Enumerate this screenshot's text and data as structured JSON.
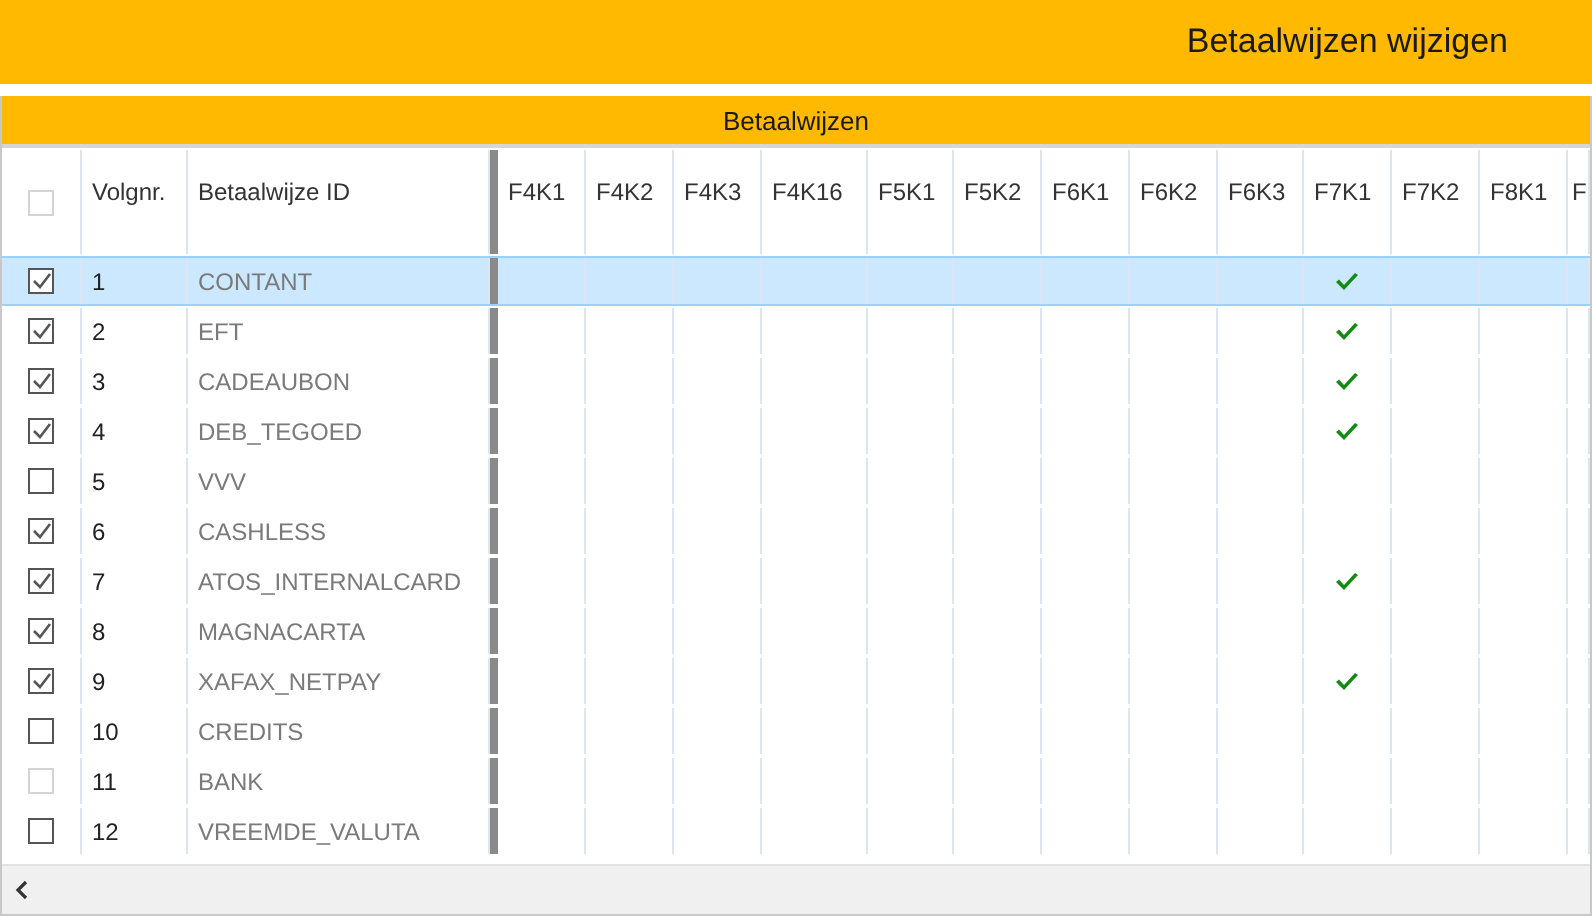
{
  "window": {
    "title": "Betaalwijzen wijzigen"
  },
  "section": {
    "title": "Betaalwijzen"
  },
  "table": {
    "select_all": {
      "checked": false,
      "disabled": true
    },
    "columns": [
      "Volgnr.",
      "Betaalwijze ID"
    ],
    "flag_columns": [
      "F4K1",
      "F4K2",
      "F4K3",
      "F4K16",
      "F5K1",
      "F5K2",
      "F6K1",
      "F6K2",
      "F6K3",
      "F7K1",
      "F7K2",
      "F8K1",
      "F"
    ],
    "rows": [
      {
        "checked": true,
        "disabled": false,
        "selected": true,
        "number": "1",
        "id": "CONTANT",
        "flags": [
          false,
          false,
          false,
          false,
          false,
          false,
          false,
          false,
          false,
          true,
          false,
          false
        ]
      },
      {
        "checked": true,
        "disabled": false,
        "selected": false,
        "number": "2",
        "id": "EFT",
        "flags": [
          false,
          false,
          false,
          false,
          false,
          false,
          false,
          false,
          false,
          true,
          false,
          false
        ]
      },
      {
        "checked": true,
        "disabled": false,
        "selected": false,
        "number": "3",
        "id": "CADEAUBON",
        "flags": [
          false,
          false,
          false,
          false,
          false,
          false,
          false,
          false,
          false,
          true,
          false,
          false
        ]
      },
      {
        "checked": true,
        "disabled": false,
        "selected": false,
        "number": "4",
        "id": "DEB_TEGOED",
        "flags": [
          false,
          false,
          false,
          false,
          false,
          false,
          false,
          false,
          false,
          true,
          false,
          false
        ]
      },
      {
        "checked": false,
        "disabled": false,
        "selected": false,
        "number": "5",
        "id": "VVV",
        "flags": [
          false,
          false,
          false,
          false,
          false,
          false,
          false,
          false,
          false,
          false,
          false,
          false
        ]
      },
      {
        "checked": true,
        "disabled": false,
        "selected": false,
        "number": "6",
        "id": "CASHLESS",
        "flags": [
          false,
          false,
          false,
          false,
          false,
          false,
          false,
          false,
          false,
          false,
          false,
          false
        ]
      },
      {
        "checked": true,
        "disabled": false,
        "selected": false,
        "number": "7",
        "id": "ATOS_INTERNALCARD",
        "flags": [
          false,
          false,
          false,
          false,
          false,
          false,
          false,
          false,
          false,
          true,
          false,
          false
        ]
      },
      {
        "checked": true,
        "disabled": false,
        "selected": false,
        "number": "8",
        "id": "MAGNACARTA",
        "flags": [
          false,
          false,
          false,
          false,
          false,
          false,
          false,
          false,
          false,
          false,
          false,
          false
        ]
      },
      {
        "checked": true,
        "disabled": false,
        "selected": false,
        "number": "9",
        "id": "XAFAX_NETPAY",
        "flags": [
          false,
          false,
          false,
          false,
          false,
          false,
          false,
          false,
          false,
          true,
          false,
          false
        ]
      },
      {
        "checked": false,
        "disabled": false,
        "selected": false,
        "number": "10",
        "id": "CREDITS",
        "flags": [
          false,
          false,
          false,
          false,
          false,
          false,
          false,
          false,
          false,
          false,
          false,
          false
        ]
      },
      {
        "checked": false,
        "disabled": true,
        "selected": false,
        "number": "11",
        "id": "BANK",
        "flags": [
          false,
          false,
          false,
          false,
          false,
          false,
          false,
          false,
          false,
          false,
          false,
          false
        ]
      },
      {
        "checked": false,
        "disabled": false,
        "selected": false,
        "number": "12",
        "id": "VREEMDE_VALUTA",
        "flags": [
          false,
          false,
          false,
          false,
          false,
          false,
          false,
          false,
          false,
          false,
          false,
          false
        ]
      }
    ]
  }
}
